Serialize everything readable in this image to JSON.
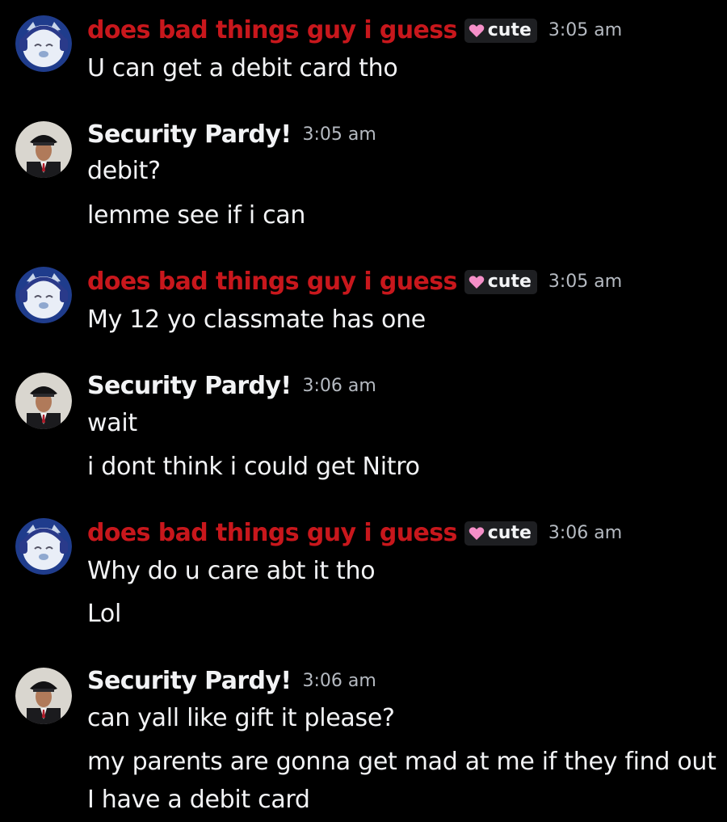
{
  "users": {
    "a": {
      "name": "does bad things guy i guess",
      "tag": "cute",
      "color": "#c8171c",
      "avatar_icon": "husky-headphones-avatar"
    },
    "b": {
      "name": "Security Pardy!",
      "color": "#f2f3f5",
      "avatar_icon": "security-guard-avatar"
    }
  },
  "messages": [
    {
      "author": "does bad things guy i guess",
      "tag": "cute",
      "time": "3:05 am",
      "lines": [
        "U can get a debit card tho"
      ]
    },
    {
      "author": "Security Pardy!",
      "time": "3:05 am",
      "lines": [
        "debit?",
        "lemme see if i can"
      ]
    },
    {
      "author": "does bad things guy i guess",
      "tag": "cute",
      "time": "3:05 am",
      "lines": [
        "My 12 yo classmate has one"
      ]
    },
    {
      "author": "Security Pardy!",
      "time": "3:06 am",
      "lines": [
        "wait",
        "i dont think i could get Nitro"
      ]
    },
    {
      "author": "does bad things guy i guess",
      "tag": "cute",
      "time": "3:06 am",
      "lines": [
        "Why do u care abt it tho",
        "Lol"
      ]
    },
    {
      "author": "Security Pardy!",
      "time": "3:06 am",
      "lines": [
        "can yall like gift it please?",
        "my parents are gonna get mad at me if they find out",
        "I have a debit card"
      ]
    }
  ]
}
